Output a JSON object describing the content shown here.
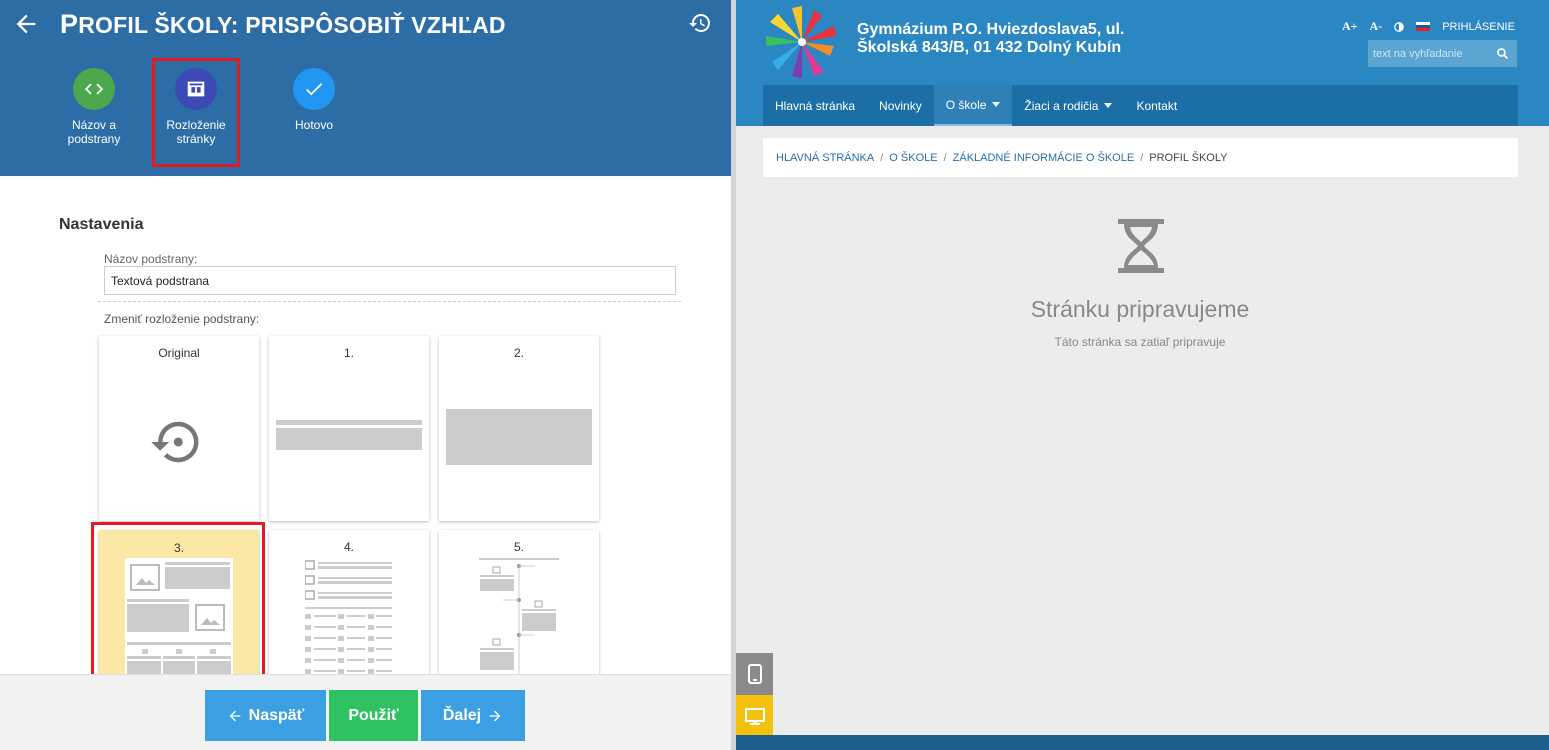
{
  "editor": {
    "title": "Profil školy: prispôsobiť vzhľad",
    "steps": [
      {
        "label": "Názov a podstrany",
        "icon": "code-icon"
      },
      {
        "label": "Rozloženie stránky",
        "icon": "layout-icon"
      },
      {
        "label": "Hotovo",
        "icon": "check-icon"
      }
    ],
    "settings_title": "Nastavenia",
    "name_label": "Názov podstrany:",
    "name_value": "Textová podstrana",
    "layout_label": "Zmeniť rozloženie podstrany:",
    "layouts": [
      "Original",
      "1.",
      "2.",
      "3.",
      "4.",
      "5."
    ],
    "selected_layout": "3.",
    "buttons": {
      "back": "Naspäť",
      "apply": "Použiť",
      "next": "Ďalej"
    },
    "colors": {
      "header": "#2d6da6",
      "selected_highlight": "#fce8a6",
      "marker": "#e21b23"
    }
  },
  "site": {
    "name_line1": "Gymnázium P.O. Hviezdoslava5, ul.",
    "name_line2": "Školská 843/B, 01 432 Dolný Kubín",
    "font_increase": "A+",
    "font_decrease": "A-",
    "login": "PRIHLÁSENIE",
    "search_placeholder": "text na vyhľadanie",
    "nav": [
      {
        "label": "Hlavná stránka"
      },
      {
        "label": "Novinky"
      },
      {
        "label": "O škole"
      },
      {
        "label": "Žiaci a rodičia"
      },
      {
        "label": "Kontakt"
      }
    ],
    "breadcrumb": [
      "HLAVNÁ STRÁNKA",
      "O ŠKOLE",
      "ZÁKLADNÉ INFORMÁCIE O ŠKOLE",
      "PROFIL ŠKOLY"
    ],
    "wip_title": "Stránku pripravujeme",
    "wip_subtitle": "Táto stránka sa zatiaľ pripravuje"
  }
}
